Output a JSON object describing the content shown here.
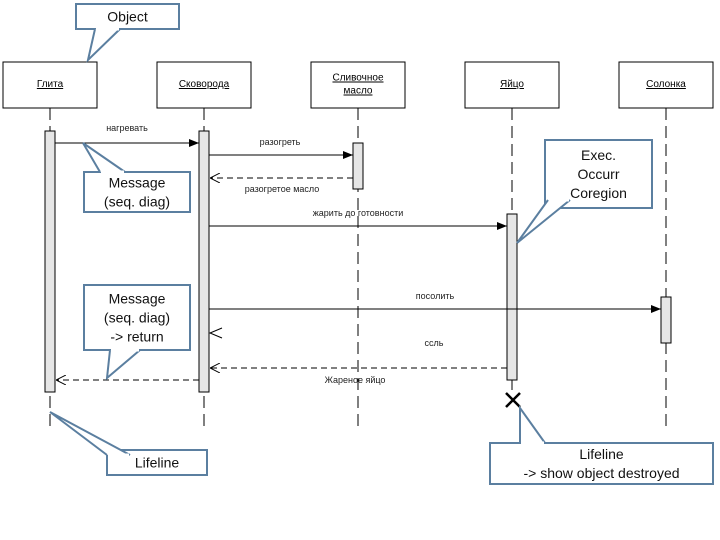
{
  "objects": [
    {
      "label": [
        "Глита"
      ]
    },
    {
      "label": [
        "Сковорода"
      ]
    },
    {
      "label": [
        "Сливочное",
        "масло"
      ]
    },
    {
      "label": [
        "Яйцо"
      ]
    },
    {
      "label": [
        "Солонка"
      ]
    }
  ],
  "messages": [
    {
      "label": "нагревать",
      "from": "Глита",
      "to": "Сковорода",
      "kind": "sync"
    },
    {
      "label": "разогреть",
      "from": "Сковорода",
      "to": "Сливочное масло",
      "kind": "sync"
    },
    {
      "label": "разогретое масло",
      "from": "Сливочное масло",
      "to": "Сковорода",
      "kind": "return"
    },
    {
      "label": "жарить до готовности",
      "from": "Сковорода",
      "to": "Яйцо",
      "kind": "sync"
    },
    {
      "label": "посолить",
      "from": "Сковорода",
      "to": "Солонка",
      "kind": "sync"
    },
    {
      "label": "ссль",
      "from": "Солонка",
      "to": "Сковорода",
      "kind": "return-arrowhead-only"
    },
    {
      "label": "",
      "from": "Яйцо",
      "to": "Сковорода",
      "kind": "return"
    },
    {
      "label": "Жареное яйцо",
      "from": "Сковорода",
      "to": "Глита",
      "kind": "return"
    }
  ],
  "callouts": [
    {
      "lines": [
        "Object"
      ]
    },
    {
      "lines": [
        "Message",
        "(seq. diag)"
      ]
    },
    {
      "lines": [
        "Message",
        "(seq. diag)",
        "-> return"
      ]
    },
    {
      "lines": [
        "Exec.",
        "Occurr",
        "Coregion"
      ]
    },
    {
      "lines": [
        "Lifeline"
      ]
    },
    {
      "lines": [
        "Lifeline",
        "-> show object destroyed"
      ]
    }
  ],
  "colors": {
    "callout_border": "#5b7fa0",
    "activation_fill": "#e6e6e6",
    "line": "#000000"
  }
}
